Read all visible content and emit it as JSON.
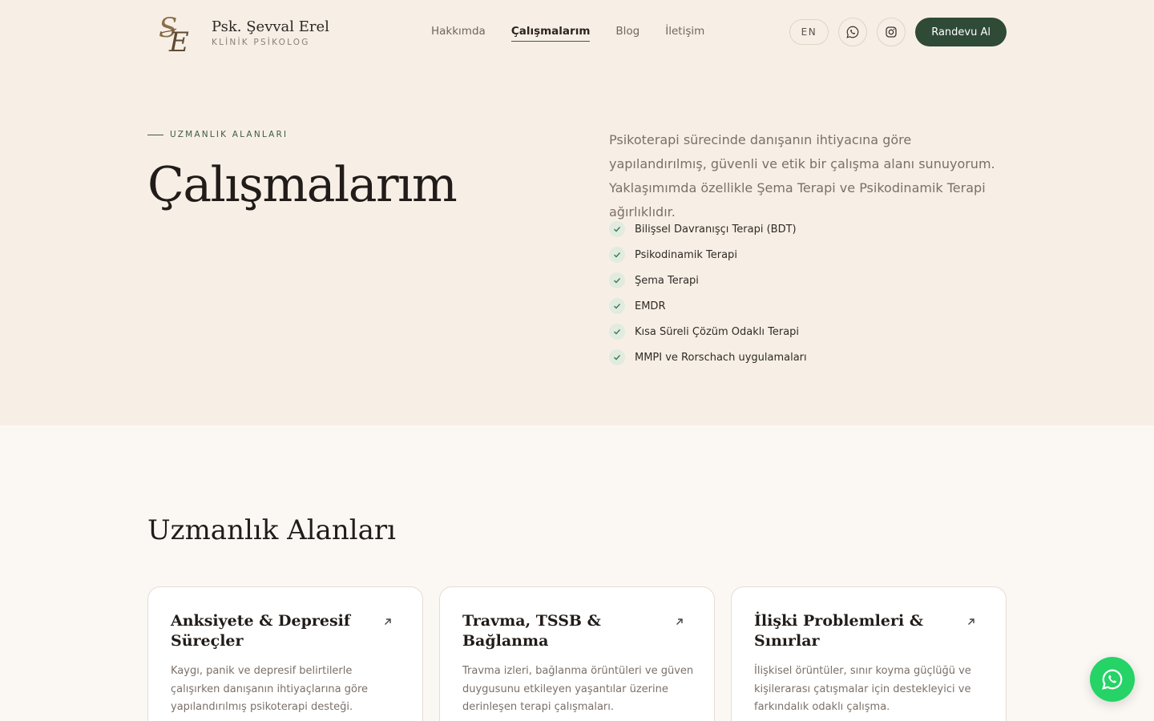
{
  "header": {
    "brand_name": "Psk. Şevval Erel",
    "brand_subtitle": "KLİNİK PSİKOLOG",
    "nav": [
      {
        "label": "Hakkımda",
        "active": false
      },
      {
        "label": "Çalışmalarım",
        "active": true
      },
      {
        "label": "Blog",
        "active": false
      },
      {
        "label": "İletişim",
        "active": false
      }
    ],
    "lang_label": "EN",
    "cta_label": "Randevu Al",
    "whatsapp_icon": "whatsapp-icon",
    "instagram_icon": "instagram-icon"
  },
  "hero": {
    "eyebrow": "UZMANLIK ALANLARI",
    "title": "Çalışmalarım",
    "description": "Psikoterapi sürecinde danışanın ihtiyacına göre yapılandırılmış, güvenli ve etik bir çalışma alanı sunuyorum. Yaklaşımımda özellikle Şema Terapi ve Psikodinamik Terapi ağırlıklıdır.",
    "checklist": [
      "Bilişsel Davranışçı Terapi (BDT)",
      "Psikodinamik Terapi",
      "Şema Terapi",
      "EMDR",
      "Kısa Süreli Çözüm Odaklı Terapi",
      "MMPI ve Rorschach uygulamaları"
    ]
  },
  "specialties": {
    "title": "Uzmanlık Alanları",
    "cards": [
      {
        "title": "Anksiyete & Depresif Süreçler",
        "text": "Kaygı, panik ve depresif belirtilerle çalışırken danışanın ihtiyaçlarına göre yapılandırılmış psikoterapi desteği."
      },
      {
        "title": "Travma, TSSB & Bağlanma",
        "text": "Travma izleri, bağlanma örüntüleri ve güven duygusunu etkileyen yaşantılar üzerine derinleşen terapi çalışmaları."
      },
      {
        "title": "İlişki Problemleri & Sınırlar",
        "text": "İlişkisel örüntüler, sınır koyma güçlüğü ve kişilerarası çatışmalar için destekleyici ve farkındalık odaklı çalışma."
      }
    ]
  },
  "colors": {
    "accent": "#2f4a37",
    "hero_bg": "#f7efe6",
    "page_bg": "#fbf8f4",
    "whatsapp": "#25d366",
    "check_bg": "#e1ebdf"
  }
}
